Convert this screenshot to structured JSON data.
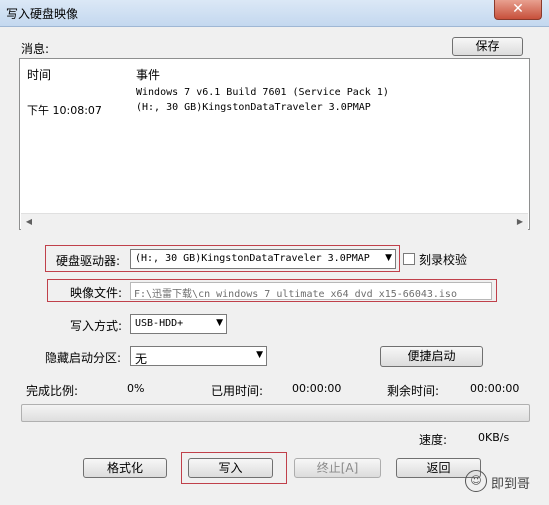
{
  "window": {
    "title": "写入硬盘映像",
    "close_glyph": "✕"
  },
  "messages": {
    "label": "消息:",
    "save_button": "保存",
    "col_time": "时间",
    "col_event": "事件",
    "rows": [
      {
        "time": "",
        "event": "Windows 7 v6.1 Build 7601 (Service Pack 1)"
      },
      {
        "time": "下午 10:08:07",
        "event": "(H:, 30 GB)KingstonDataTraveler 3.0PMAP"
      }
    ]
  },
  "drive": {
    "label": "硬盘驱动器:",
    "value": "(H:, 30 GB)KingstonDataTraveler 3.0PMAP",
    "verify_label": "刻录校验"
  },
  "image_file": {
    "label": "映像文件:",
    "value": "F:\\迅雷下载\\cn_windows_7_ultimate_x64_dvd_x15-66043.iso"
  },
  "write_method": {
    "label": "写入方式:",
    "value": "USB-HDD+"
  },
  "hidden_partition": {
    "label": "隐藏启动分区:",
    "value": "无"
  },
  "quick_boot_button": "便捷启动",
  "status": {
    "complete_label": "完成比例:",
    "complete_value": "0%",
    "elapsed_label": "已用时间:",
    "elapsed_value": "00:00:00",
    "remaining_label": "剩余时间:",
    "remaining_value": "00:00:00",
    "speed_label": "速度:",
    "speed_value": "0KB/s",
    "progress": 0
  },
  "buttons": {
    "format": "格式化",
    "write": "写入",
    "stop": "终止[A]",
    "back": "返回"
  },
  "watermark": {
    "text": "即到哥",
    "icon_glyph": "☺"
  }
}
